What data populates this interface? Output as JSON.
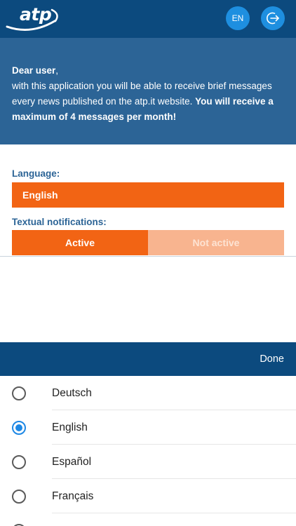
{
  "header": {
    "logo_text": "atp",
    "language_button": "EN",
    "logout_icon": "logout-icon"
  },
  "intro": {
    "greeting": "Dear user",
    "body": "with this application you will be able to receive brief messages every news published on the atp.it website. ",
    "emphasis": "You will receive a maximum of 4 messages per month!"
  },
  "form": {
    "language_label": "Language:",
    "language_value": "English",
    "notifications_label": "Textual notifications:",
    "toggle_active": "Active",
    "toggle_inactive": "Not active",
    "selected_toggle": "Active"
  },
  "picker": {
    "done_label": "Done",
    "selected": "English",
    "options": [
      {
        "label": "Deutsch"
      },
      {
        "label": "English"
      },
      {
        "label": "Español"
      },
      {
        "label": "Français"
      }
    ]
  },
  "colors": {
    "header_bg": "#0c4a7e",
    "intro_bg": "#2c6496",
    "accent_orange": "#f26414",
    "inactive_orange": "#f8b48f",
    "button_blue": "#1e8fe0",
    "radio_selected": "#1e88e5"
  }
}
